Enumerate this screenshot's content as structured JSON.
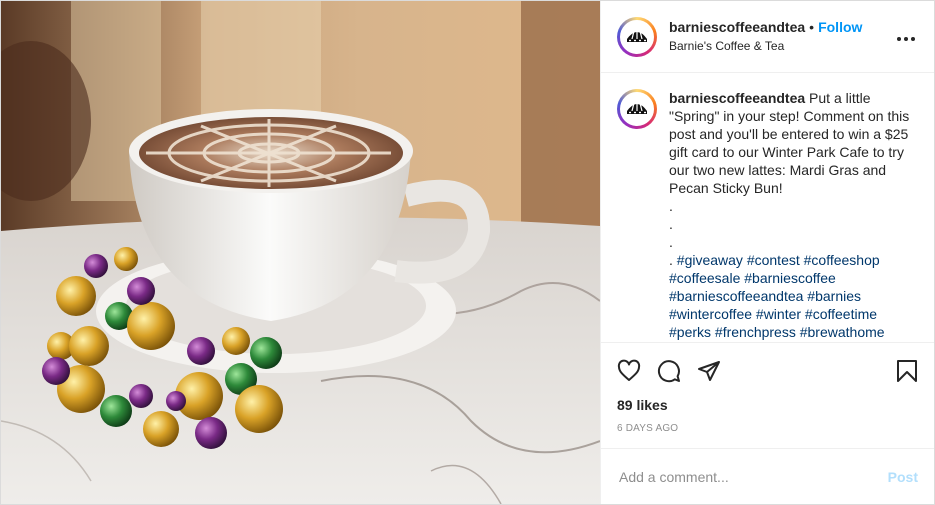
{
  "post": {
    "image_alt": "Latte with spider-web art on a saucer surrounded by Mardi Gras beads",
    "header": {
      "username": "barniescoffeeandtea",
      "separator": "•",
      "follow_label": "Follow",
      "location": "Barnie's Coffee & Tea",
      "more_icon": "more-horizontal-icon"
    },
    "caption": {
      "username": "barniescoffeeandtea",
      "text": " Put a little \"Spring\" in your step! Comment on this post and you'll be entered to win a $25 gift card to our Winter Park Cafe to try our two new lattes: Mardi Gras and Pecan Sticky Bun!\n.\n.\n.\n. ",
      "hashtags": "#giveaway #contest #coffeeshop #coffeesale #barniescoffee #barniescoffeeandtea #barnies #wintercoffee #winter #coffeetime #perks #frenchpress #brewathome #espresso #love #barista #latte #tea"
    },
    "actions": {
      "like_icon": "heart-icon",
      "comment_icon": "comment-icon",
      "share_icon": "paper-plane-icon",
      "save_icon": "bookmark-icon"
    },
    "likes": "89 likes",
    "timestamp": "6 DAYS AGO",
    "add_comment": {
      "placeholder": "Add a comment...",
      "post_label": "Post"
    },
    "colors": {
      "follow": "#0095f6",
      "hashtag": "#00376b",
      "post_disabled": "#b2dffc"
    }
  }
}
